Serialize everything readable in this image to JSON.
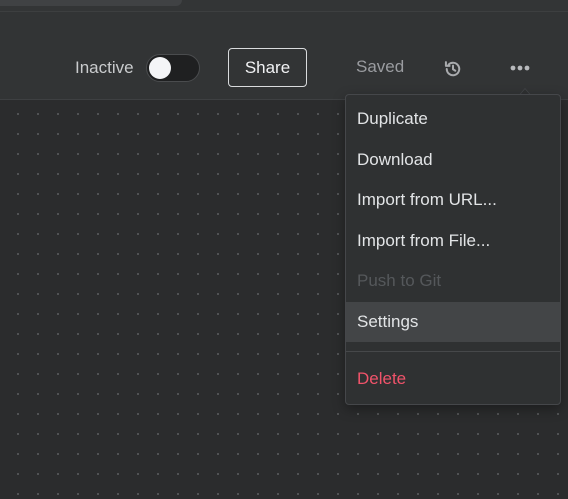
{
  "header": {
    "active_toggle": {
      "label": "Inactive",
      "on": false
    },
    "share_label": "Share",
    "save_status": "Saved",
    "history_icon": "history-icon",
    "more_icon": "ellipsis-horizontal-icon"
  },
  "menu": {
    "items": [
      {
        "label": "Duplicate",
        "enabled": true
      },
      {
        "label": "Download",
        "enabled": true
      },
      {
        "label": "Import from URL...",
        "enabled": true
      },
      {
        "label": "Import from File...",
        "enabled": true
      },
      {
        "label": "Push to Git",
        "enabled": false
      },
      {
        "label": "Settings",
        "enabled": true,
        "highlighted": true
      }
    ],
    "danger_item": {
      "label": "Delete",
      "color": "#f0536a"
    }
  },
  "colors": {
    "canvas_bg": "#2b2c2d",
    "header_bg": "#323435",
    "menu_bg": "#2f3132",
    "danger": "#f0536a"
  }
}
